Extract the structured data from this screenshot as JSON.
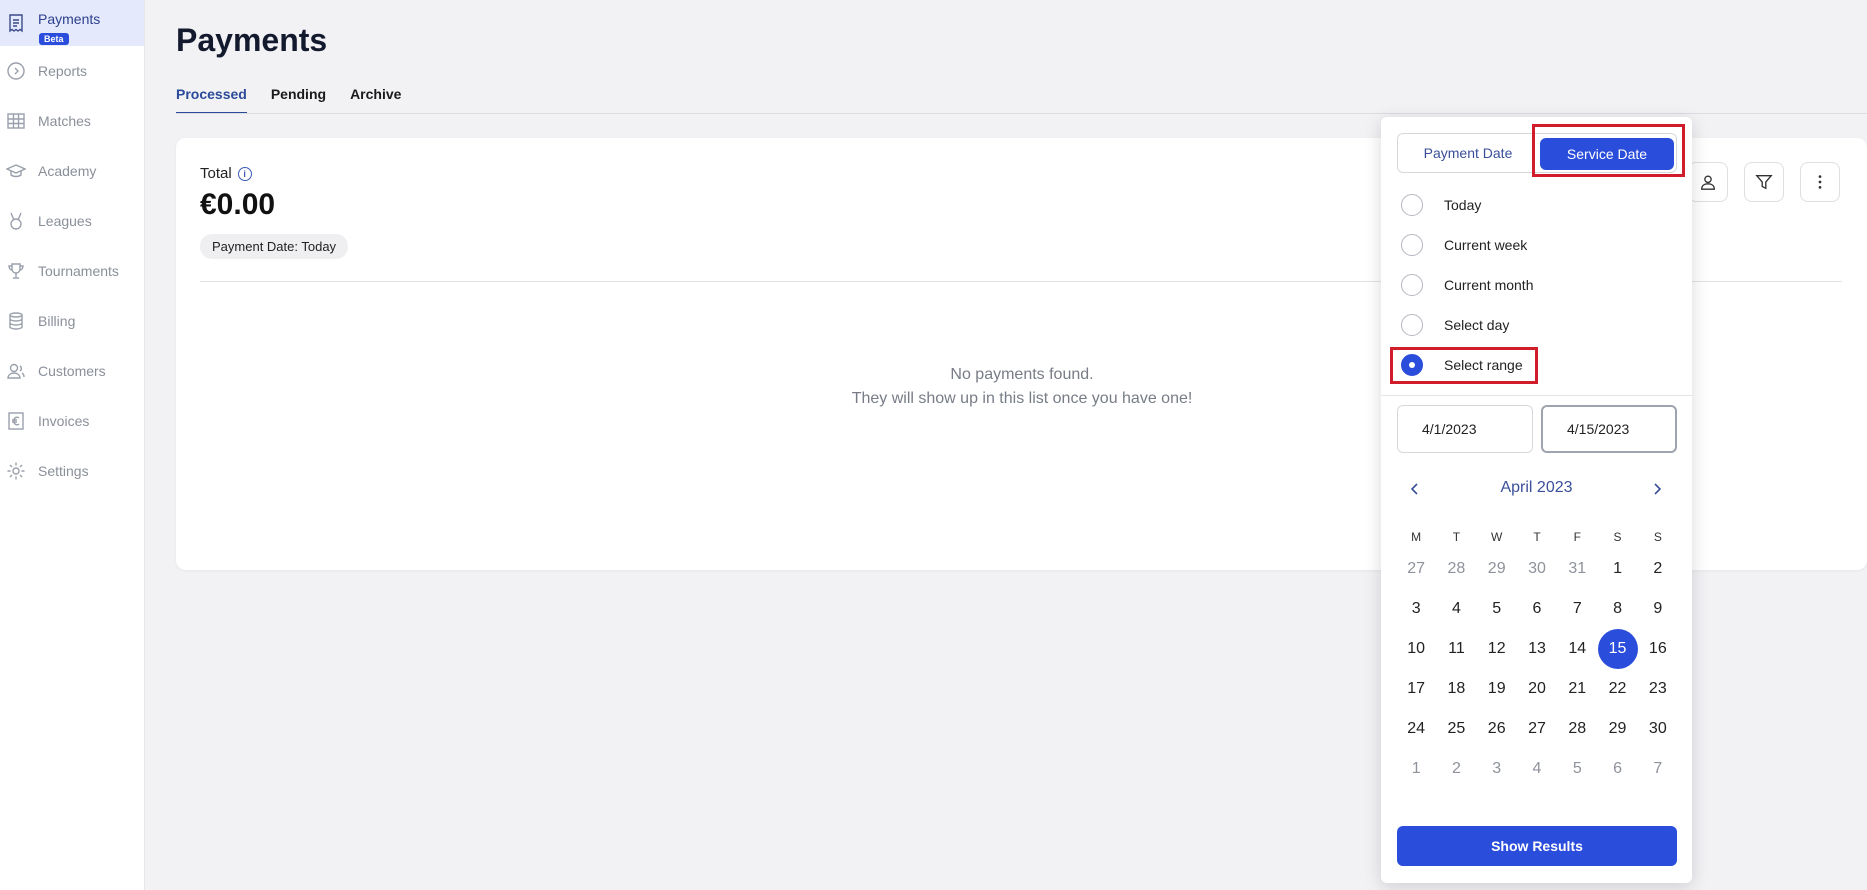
{
  "sidebar": {
    "items": [
      {
        "label": "Payments",
        "icon": "receipt-icon",
        "active": true,
        "badge": "Beta"
      },
      {
        "label": "Reports",
        "icon": "reports-icon"
      },
      {
        "label": "Matches",
        "icon": "grid-icon"
      },
      {
        "label": "Academy",
        "icon": "graduation-cap-icon"
      },
      {
        "label": "Leagues",
        "icon": "medal-icon"
      },
      {
        "label": "Tournaments",
        "icon": "trophy-icon"
      },
      {
        "label": "Billing",
        "icon": "database-icon"
      },
      {
        "label": "Customers",
        "icon": "users-icon"
      },
      {
        "label": "Invoices",
        "icon": "euro-icon"
      },
      {
        "label": "Settings",
        "icon": "gear-icon"
      }
    ]
  },
  "page": {
    "title": "Payments",
    "tabs": [
      "Processed",
      "Pending",
      "Archive"
    ],
    "active_tab": "Processed"
  },
  "card": {
    "total_label": "Total",
    "total_value": "€0.00",
    "chip": "Payment Date:  Today",
    "empty_line1": "No payments found.",
    "empty_line2": "They will show up in this list once you have one!"
  },
  "toolbar": {
    "icons": [
      "user-icon",
      "filter-icon",
      "more-vertical-icon"
    ]
  },
  "popover": {
    "segment_left": "Payment Date",
    "segment_right": "Service Date",
    "options": [
      "Today",
      "Current week",
      "Current month",
      "Select day",
      "Select range"
    ],
    "selected_option": "Select range",
    "start_date": "4/1/2023",
    "end_date": "4/15/2023",
    "month_label": "April 2023",
    "weekdays": [
      "M",
      "T",
      "W",
      "T",
      "F",
      "S",
      "S"
    ],
    "weeks": [
      [
        "27",
        "28",
        "29",
        "30",
        "31",
        "1",
        "2"
      ],
      [
        "3",
        "4",
        "5",
        "6",
        "7",
        "8",
        "9"
      ],
      [
        "10",
        "11",
        "12",
        "13",
        "14",
        "15",
        "16"
      ],
      [
        "17",
        "18",
        "19",
        "20",
        "21",
        "22",
        "23"
      ],
      [
        "24",
        "25",
        "26",
        "27",
        "28",
        "29",
        "30"
      ],
      [
        "1",
        "2",
        "3",
        "4",
        "5",
        "6",
        "7"
      ]
    ],
    "selected_day": "15",
    "show_results": "Show Results"
  },
  "colors": {
    "accent": "#2b4ddb",
    "highlight": "#d01c2b",
    "active_tab": "#2b4a9a"
  }
}
